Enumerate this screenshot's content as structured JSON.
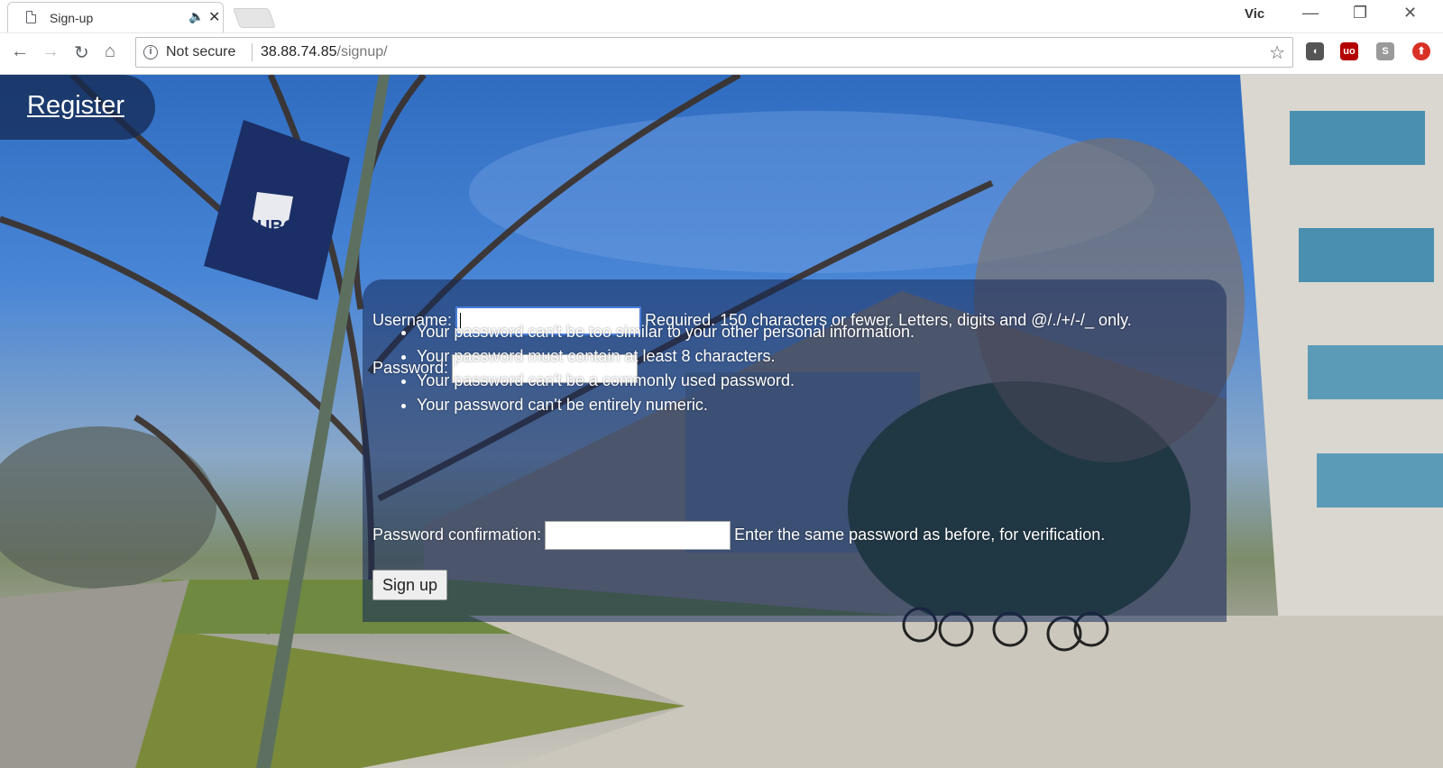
{
  "browser": {
    "tab_title": "Sign-up",
    "profile_name": "Vic",
    "security_label": "Not secure",
    "url_host": "38.88.74.85",
    "url_path": "/signup/"
  },
  "header": {
    "register_link": "Register"
  },
  "banner": {
    "logo_text": "UBC"
  },
  "form": {
    "username_label": "Username:",
    "username_value": "",
    "username_help": "Required. 150 characters or fewer. Letters, digits and @/./+/-/_ only.",
    "password_label": "Password:",
    "password_value": "",
    "password_hints": [
      "Your password can't be too similar to your other personal information.",
      "Your password must contain at least 8 characters.",
      "Your password can't be a commonly used password.",
      "Your password can't be entirely numeric."
    ],
    "confirm_label": "Password confirmation:",
    "confirm_value": "",
    "confirm_help": "Enter the same password as before, for verification.",
    "submit_label": "Sign up"
  },
  "colors": {
    "panel": "#142a5a",
    "register_bg": "#142850",
    "banner": "#1b2f66",
    "focus_ring": "#4a7ed8"
  }
}
